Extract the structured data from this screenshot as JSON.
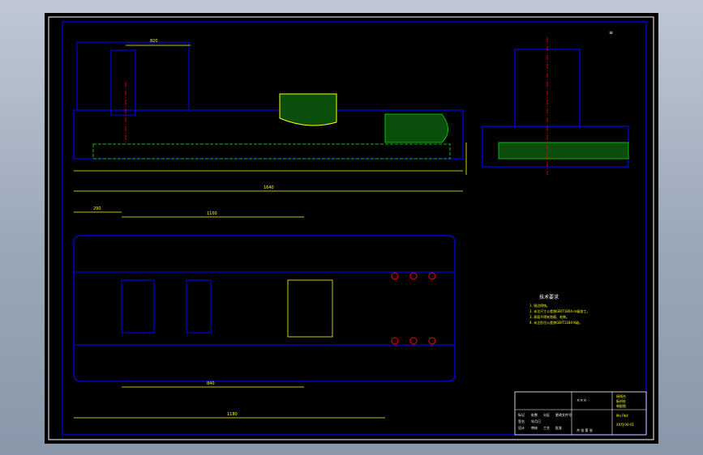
{
  "screen": {
    "frame_mark": "≡"
  },
  "drawing": {
    "tech_req_title": "技术要求",
    "tech_req_lines": [
      "1. 锐边倒钝。",
      "2. 未注尺寸公差按GB/T1804-m级加工。",
      "3. 表面不得有划痕、毛刺。",
      "4. 未注形位公差按GB/T1184-K级。"
    ],
    "dims": {
      "overall_length": "1640",
      "top_len": "820",
      "plan_top": "1100",
      "plan_mid": "840",
      "plan_bottom": "1180",
      "plan_small": "290"
    },
    "title_block": {
      "center_text": "×××",
      "right_name": "接线台",
      "right_sub1": "板材处",
      "right_sub2": "装配图",
      "material": "Mn Pb4",
      "drawing_no": "XXYJ-00-01",
      "cells": [
        "标记",
        "处数",
        "分区",
        "更改文件号",
        "签名",
        "年月日",
        "设计",
        "审核",
        "工艺",
        "批准"
      ],
      "footer": "共 张  第 张"
    }
  },
  "colors": {
    "background": "#000000",
    "outline": "#0000ff",
    "dimension": "#ffff00",
    "hatch": "#00c000",
    "hidden": "#00c000",
    "center": "#ff0000",
    "text": "#ffffff"
  }
}
